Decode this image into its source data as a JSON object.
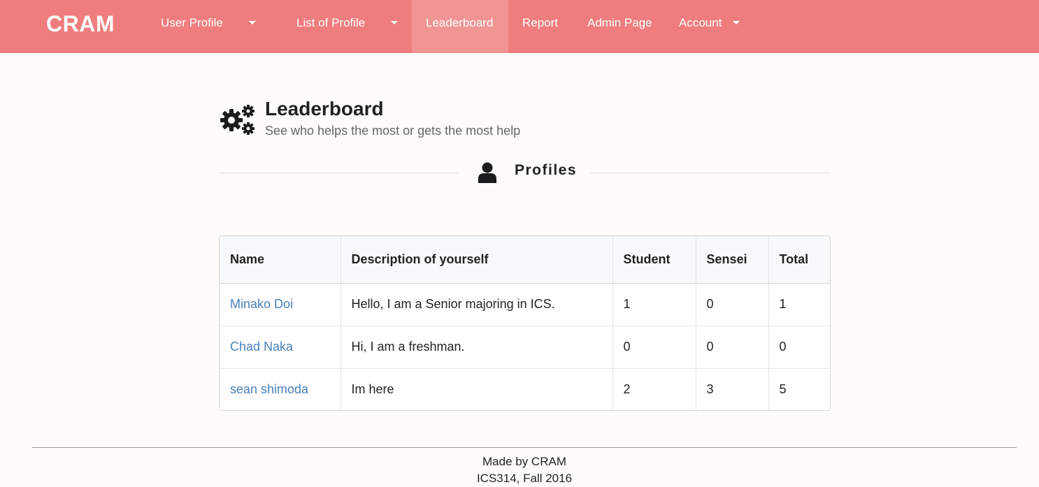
{
  "navbar": {
    "brand": "CRAM",
    "items": [
      {
        "label": "User Profile",
        "dropdown": true
      },
      {
        "label": "List of Profile",
        "dropdown": true
      },
      {
        "label": "Leaderboard",
        "active": true
      },
      {
        "label": "Report"
      },
      {
        "label": "Admin Page"
      },
      {
        "label": "Account",
        "dropdown": true
      }
    ]
  },
  "header": {
    "icon": "gears-icon",
    "title": "Leaderboard",
    "subtitle": "See who helps the most or gets the most help"
  },
  "section": {
    "icon": "user-icon",
    "label": "Profiles"
  },
  "table": {
    "columns": [
      "Name",
      "Description of yourself",
      "Student",
      "Sensei",
      "Total"
    ],
    "rows": [
      {
        "name": "Minako Doi",
        "description": "Hello, I am a Senior majoring in ICS.",
        "student": "1",
        "sensei": "0",
        "total": "1"
      },
      {
        "name": "Chad Naka",
        "description": "Hi, I am a freshman.",
        "student": "0",
        "sensei": "0",
        "total": "0"
      },
      {
        "name": "sean shimoda",
        "description": "Im here",
        "student": "2",
        "sensei": "3",
        "total": "5"
      }
    ]
  },
  "footer": {
    "line1": "Made by CRAM",
    "line2": "ICS314, Fall 2016"
  },
  "colors": {
    "navbar": "#f07d7d",
    "navbar_active": "#f19494",
    "link": "#4a7fba"
  }
}
